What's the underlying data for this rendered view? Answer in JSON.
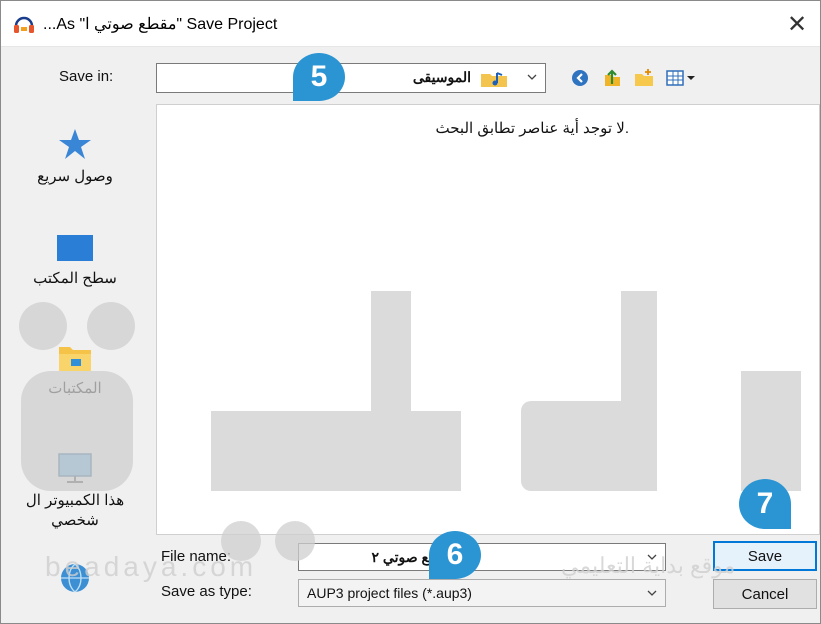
{
  "window": {
    "title": "...As \"مقطع صوتي ا\" Save Project",
    "close_glyph": "✕"
  },
  "save_in": {
    "label": "Save in:",
    "folder": "الموسيقى"
  },
  "toolbar": {
    "icons": [
      "back-icon",
      "up-folder-icon",
      "new-folder-icon",
      "view-menu-icon"
    ]
  },
  "sidebar": {
    "items": [
      {
        "label": "وصول سريع",
        "icon": "quick-access-star-icon"
      },
      {
        "label": "سطح المكتب",
        "icon": "desktop-icon"
      },
      {
        "label": "المكتبات",
        "icon": "libraries-folder-icon"
      },
      {
        "label": "هذا الكمبيوتر ال شخصي",
        "icon": "this-pc-icon"
      },
      {
        "label": "",
        "icon": "network-icon"
      }
    ]
  },
  "file_list": {
    "empty_message": ".لا توجد أية عناصر تطابق البحث"
  },
  "file_name": {
    "label": "File name:",
    "value": "مقطع صوتي ٢"
  },
  "save_as_type": {
    "label": "Save as type:",
    "value": "AUP3 project files (*.aup3)"
  },
  "buttons": {
    "save": "Save",
    "cancel": "Cancel"
  },
  "callouts": {
    "step_5": "5",
    "step_6": "6",
    "step_7": "7"
  },
  "watermark": {
    "text": "beadaya.com",
    "arabic": "موقع بداية التعليمي"
  },
  "colors": {
    "callout": "#2b95d3",
    "default_button_border": "#0078d7",
    "watermark": "#d0d0d0"
  }
}
